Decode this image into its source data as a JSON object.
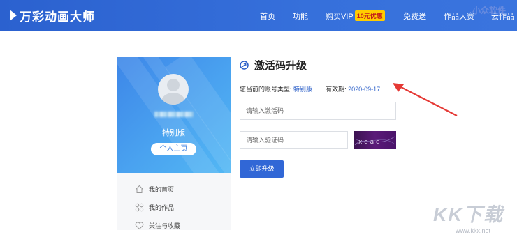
{
  "header": {
    "logo_text": "万彩动画大师",
    "nav": [
      "首页",
      "功能",
      "购买VIP",
      "免费送",
      "作品大赛",
      "云作品"
    ],
    "vip_badge": "10元优惠",
    "watermark_top": "小众软件"
  },
  "profile": {
    "edition": "特别版",
    "home_button": "个人主页"
  },
  "side_menu": [
    {
      "label": "我的首页",
      "icon": "home-icon"
    },
    {
      "label": "我的作品",
      "icon": "grid-icon"
    },
    {
      "label": "关注与收藏",
      "icon": "heart-icon"
    }
  ],
  "activation": {
    "title": "激活码升级",
    "account_type_label": "您当前的账号类型:",
    "account_type_value": "特别版",
    "expiry_label": "有效期:",
    "expiry_value": "2020-09-17",
    "code_placeholder": "请输入激活码",
    "verify_placeholder": "请输入验证码",
    "captcha_text": "x e a c",
    "submit": "立即升级"
  },
  "watermark": {
    "logo": "KK下载",
    "url": "www.kkx.net"
  },
  "colors": {
    "nav_bg": "#2b61cf",
    "primary": "#3167d6",
    "link_blue": "#2a5ec8",
    "arrow_red": "#e53935",
    "captcha_bg": "#4a146a"
  }
}
